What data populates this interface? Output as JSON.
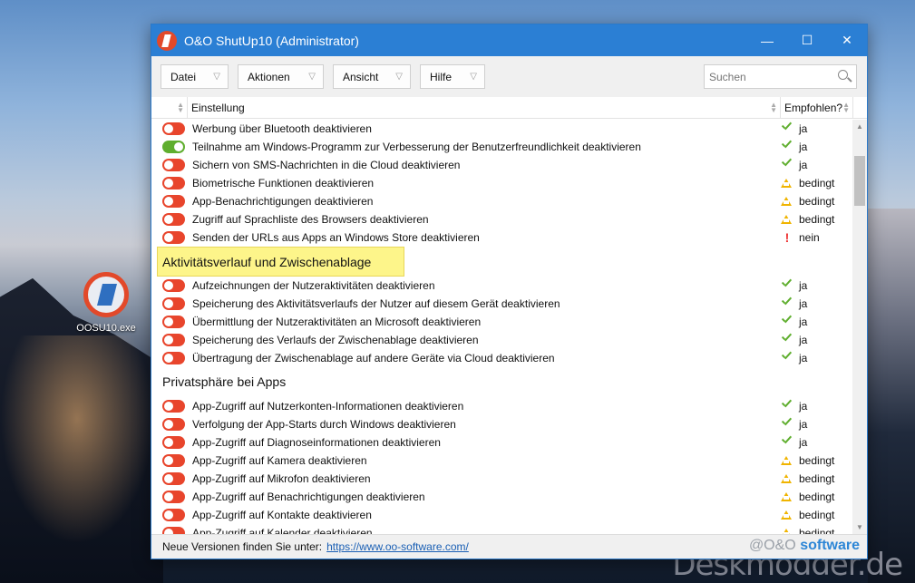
{
  "desktop": {
    "icon_label": "OOSU10.exe",
    "watermark": "Deskmodder.de"
  },
  "window": {
    "title": "O&O ShutUp10 (Administrator)",
    "controls": {
      "minimize": "—",
      "maximize": "☐",
      "close": "✕"
    }
  },
  "toolbar": {
    "menus": [
      "Datei",
      "Aktionen",
      "Ansicht",
      "Hilfe"
    ],
    "search_placeholder": "Suchen"
  },
  "table": {
    "col_setting": "Einstellung",
    "col_recommended": "Empfohlen?"
  },
  "groups": [
    {
      "title": "",
      "highlight": false,
      "rows": [
        {
          "on": false,
          "label": "Werbung über Bluetooth deaktivieren",
          "rec": "ja"
        },
        {
          "on": true,
          "label": "Teilnahme am Windows-Programm zur Verbesserung der Benutzerfreundlichkeit deaktivieren",
          "rec": "ja"
        },
        {
          "on": false,
          "label": "Sichern von SMS-Nachrichten in die Cloud deaktivieren",
          "rec": "ja"
        },
        {
          "on": false,
          "label": "Biometrische Funktionen deaktivieren",
          "rec": "bedingt"
        },
        {
          "on": false,
          "label": "App-Benachrichtigungen deaktivieren",
          "rec": "bedingt"
        },
        {
          "on": false,
          "label": "Zugriff auf Sprachliste des Browsers deaktivieren",
          "rec": "bedingt"
        },
        {
          "on": false,
          "label": "Senden der URLs aus Apps an Windows Store deaktivieren",
          "rec": "nein"
        }
      ]
    },
    {
      "title": "Aktivitätsverlauf und Zwischenablage",
      "highlight": true,
      "rows": [
        {
          "on": false,
          "label": "Aufzeichnungen der Nutzeraktivitäten deaktivieren",
          "rec": "ja"
        },
        {
          "on": false,
          "label": "Speicherung des Aktivitätsverlaufs der Nutzer auf diesem Gerät deaktivieren",
          "rec": "ja"
        },
        {
          "on": false,
          "label": "Übermittlung der Nutzeraktivitäten an Microsoft deaktivieren",
          "rec": "ja"
        },
        {
          "on": false,
          "label": "Speicherung des Verlaufs der Zwischenablage deaktivieren",
          "rec": "ja"
        },
        {
          "on": false,
          "label": "Übertragung der Zwischenablage auf andere Geräte via Cloud deaktivieren",
          "rec": "ja"
        }
      ]
    },
    {
      "title": "Privatsphäre bei Apps",
      "highlight": false,
      "rows": [
        {
          "on": false,
          "label": "App-Zugriff auf Nutzerkonten-Informationen deaktivieren",
          "rec": "ja"
        },
        {
          "on": false,
          "label": "Verfolgung der App-Starts durch Windows deaktivieren",
          "rec": "ja"
        },
        {
          "on": false,
          "label": "App-Zugriff auf Diagnoseinformationen deaktivieren",
          "rec": "ja"
        },
        {
          "on": false,
          "label": "App-Zugriff auf Kamera deaktivieren",
          "rec": "bedingt"
        },
        {
          "on": false,
          "label": "App-Zugriff auf Mikrofon deaktivieren",
          "rec": "bedingt"
        },
        {
          "on": false,
          "label": "App-Zugriff auf Benachrichtigungen deaktivieren",
          "rec": "bedingt"
        },
        {
          "on": false,
          "label": "App-Zugriff auf Kontakte deaktivieren",
          "rec": "bedingt"
        },
        {
          "on": false,
          "label": "App-Zugriff auf Kalender deaktivieren",
          "rec": "bedingt"
        }
      ]
    }
  ],
  "status": {
    "text": "Neue Versionen finden Sie unter:",
    "link": "https://www.oo-software.com/",
    "brand_prefix": "@O&O",
    "brand_suffix": "software"
  },
  "colors": {
    "titlebar": "#2b7fd4",
    "toggle_off": "#e8452c",
    "toggle_on": "#5fae2e",
    "rec_ja": "#5fae2e",
    "rec_bedingt": "#f0b400",
    "rec_nein": "#e33333",
    "highlight": "#fdf58a"
  }
}
